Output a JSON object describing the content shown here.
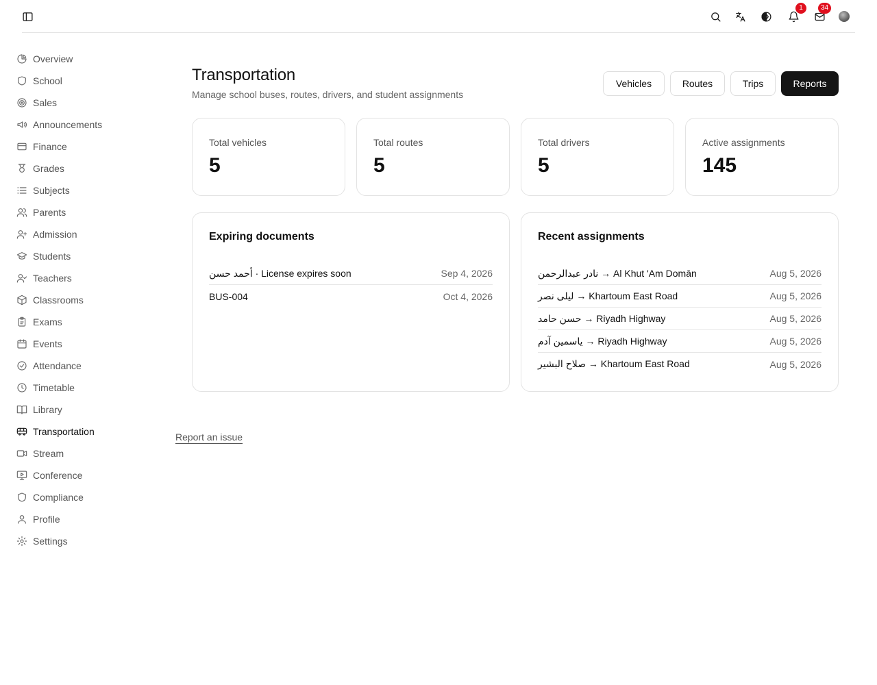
{
  "topbar": {
    "notifications_count": "1",
    "messages_count": "34"
  },
  "sidebar": {
    "items": [
      {
        "label": "Overview",
        "icon": "pie-chart-icon"
      },
      {
        "label": "School",
        "icon": "shield-icon"
      },
      {
        "label": "Sales",
        "icon": "target-icon"
      },
      {
        "label": "Announcements",
        "icon": "megaphone-icon"
      },
      {
        "label": "Finance",
        "icon": "credit-card-icon"
      },
      {
        "label": "Grades",
        "icon": "medal-icon"
      },
      {
        "label": "Subjects",
        "icon": "list-icon"
      },
      {
        "label": "Parents",
        "icon": "users-icon"
      },
      {
        "label": "Admission",
        "icon": "user-plus-icon"
      },
      {
        "label": "Students",
        "icon": "graduation-cap-icon"
      },
      {
        "label": "Teachers",
        "icon": "user-check-icon"
      },
      {
        "label": "Classrooms",
        "icon": "box-icon"
      },
      {
        "label": "Exams",
        "icon": "clipboard-icon"
      },
      {
        "label": "Events",
        "icon": "calendar-icon"
      },
      {
        "label": "Attendance",
        "icon": "check-circle-icon"
      },
      {
        "label": "Timetable",
        "icon": "clock-icon"
      },
      {
        "label": "Library",
        "icon": "book-open-icon"
      },
      {
        "label": "Transportation",
        "icon": "bus-icon",
        "active": true
      },
      {
        "label": "Stream",
        "icon": "video-icon"
      },
      {
        "label": "Conference",
        "icon": "monitor-play-icon"
      },
      {
        "label": "Compliance",
        "icon": "shield-icon"
      },
      {
        "label": "Profile",
        "icon": "user-icon"
      },
      {
        "label": "Settings",
        "icon": "gear-icon"
      }
    ]
  },
  "header": {
    "title": "Transportation",
    "subtitle": "Manage school buses, routes, drivers, and student assignments",
    "buttons": [
      "Vehicles",
      "Routes",
      "Trips",
      "Reports"
    ]
  },
  "stats": [
    {
      "label": "Total vehicles",
      "value": "5"
    },
    {
      "label": "Total routes",
      "value": "5"
    },
    {
      "label": "Total drivers",
      "value": "5"
    },
    {
      "label": "Active assignments",
      "value": "145"
    }
  ],
  "expiring": {
    "title": "Expiring documents",
    "rows": [
      {
        "left": "أحمد حسن · License expires soon",
        "right": "Sep 4, 2026"
      },
      {
        "left": "BUS-004",
        "right": "Oct 4, 2026"
      }
    ]
  },
  "recent": {
    "title": "Recent assignments",
    "rows": [
      {
        "left": "نادر عبدالرحمن → Al Khut 'Am Domān",
        "right": "Aug 5, 2026"
      },
      {
        "left": "ليلى نصر → Khartoum East Road",
        "right": "Aug 5, 2026"
      },
      {
        "left": "حسن حامد → Riyadh Highway",
        "right": "Aug 5, 2026"
      },
      {
        "left": "ياسمين آدم → Riyadh Highway",
        "right": "Aug 5, 2026"
      },
      {
        "left": "صلاح البشير → Khartoum East Road",
        "right": "Aug 5, 2026"
      }
    ]
  },
  "footer": {
    "report_link": "Report an issue"
  },
  "colors": {
    "badge": "#e0101e",
    "primary_button": "#151515",
    "border": "#e3e3e3"
  }
}
